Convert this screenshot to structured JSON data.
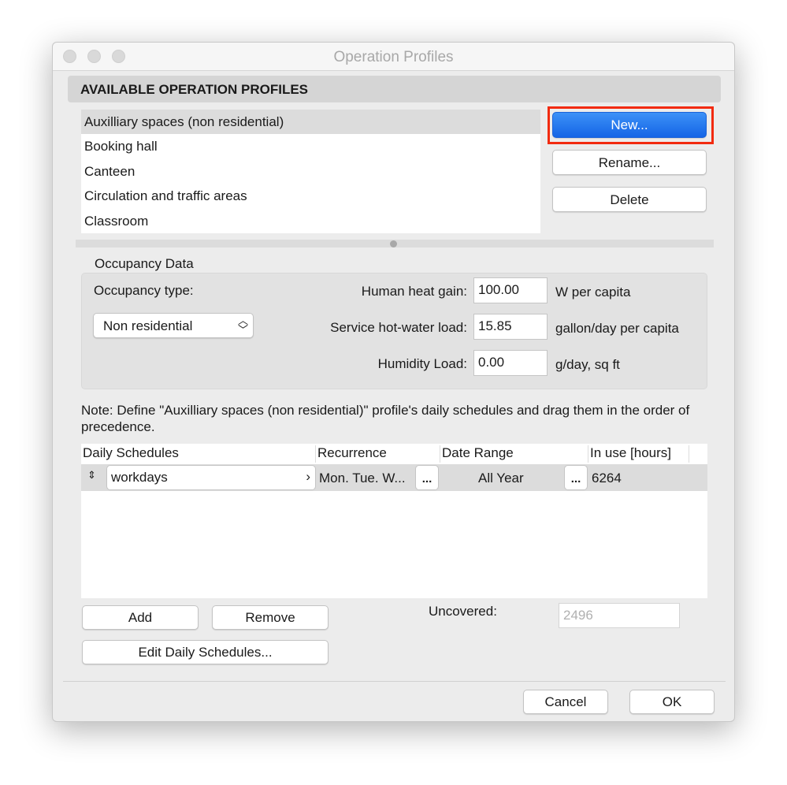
{
  "window": {
    "title": "Operation Profiles"
  },
  "header": "AVAILABLE OPERATION PROFILES",
  "profiles": [
    "Auxilliary spaces (non residential)",
    "Booking hall",
    "Canteen",
    "Circulation and traffic areas",
    "Classroom"
  ],
  "buttons": {
    "new": "New...",
    "rename": "Rename...",
    "delete": "Delete",
    "add": "Add",
    "remove": "Remove",
    "edit": "Edit Daily Schedules...",
    "cancel": "Cancel",
    "ok": "OK"
  },
  "occupancy": {
    "group_title": "Occupancy Data",
    "type_label": "Occupancy type:",
    "type_value": "Non residential",
    "heat_label": "Human heat gain:",
    "heat_value": "100.00",
    "heat_unit": "W per capita",
    "water_label": "Service hot-water load:",
    "water_value": "15.85",
    "water_unit": "gallon/day per capita",
    "humidity_label": "Humidity Load:",
    "humidity_value": "0.00",
    "humidity_unit": "g/day, sq ft"
  },
  "note": "Note: Define \"Auxilliary spaces (non residential)\" profile's daily schedules and drag them in the order of precedence.",
  "table": {
    "headers": [
      "Daily Schedules",
      "Recurrence",
      "Date Range",
      "In use [hours]"
    ],
    "rows": [
      {
        "schedule": "workdays",
        "recurrence": "Mon. Tue. W...",
        "range": "All Year",
        "hours": "6264"
      }
    ]
  },
  "uncovered": {
    "label": "Uncovered:",
    "value": "2496"
  },
  "colors": {
    "accent": "#1a6ff0",
    "highlight": "#f22b10"
  }
}
